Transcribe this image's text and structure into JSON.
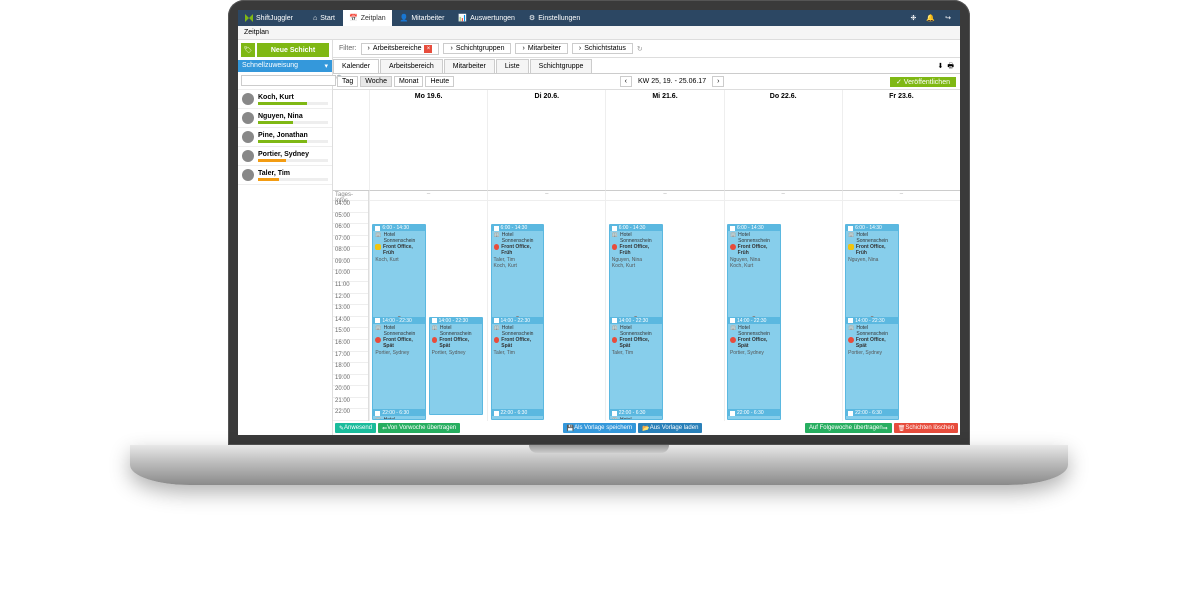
{
  "brand": "ShiftJuggler",
  "nav": {
    "start": "Start",
    "zeitplan": "Zeitplan",
    "mitarbeiter": "Mitarbeiter",
    "auswertungen": "Auswertungen",
    "einstellungen": "Einstellungen"
  },
  "crumb": "Zeitplan",
  "sidebar": {
    "new_shift": "Neue Schicht",
    "quick_assign": "Schnellzuweisung",
    "employees": [
      {
        "name": "Koch, Kurt"
      },
      {
        "name": "Nguyen, Nina"
      },
      {
        "name": "Pine, Jonathan"
      },
      {
        "name": "Portier, Sydney"
      },
      {
        "name": "Taler, Tim"
      }
    ]
  },
  "filter": {
    "label": "Filter:",
    "arbeitsbereiche": "Arbeitsbereiche",
    "schichtgruppen": "Schichtgruppen",
    "mitarbeiter": "Mitarbeiter",
    "schichtstatus": "Schichtstatus"
  },
  "tabs": {
    "kalender": "Kalender",
    "arbeitsbereich": "Arbeitsbereich",
    "mitarbeiter": "Mitarbeiter",
    "liste": "Liste",
    "schichtgruppe": "Schichtgruppe"
  },
  "view": {
    "tag": "Tag",
    "woche": "Woche",
    "monat": "Monat",
    "heute": "Heute",
    "week_label": "KW 25, 19. - 25.06.17",
    "publish": "✓ Veröffentlichen"
  },
  "grid": {
    "tages_infos": "Tages-Infos",
    "hours": [
      "04:00",
      "05:00",
      "06:00",
      "07:00",
      "08:00",
      "09:00",
      "10:00",
      "11:00",
      "12:00",
      "13:00",
      "14:00",
      "15:00",
      "16:00",
      "17:00",
      "18:00",
      "19:00",
      "20:00",
      "21:00",
      "22:00"
    ],
    "days": [
      {
        "label": "Mo 19.6."
      },
      {
        "label": "Di 20.6."
      },
      {
        "label": "Mi 21.6."
      },
      {
        "label": "Do 22.6."
      },
      {
        "label": "Fr 23.6."
      }
    ]
  },
  "shifts": {
    "early_time": "6:00 - 14:30",
    "late_time": "14:00 - 22:30",
    "night_time": "22:00 - 6:30",
    "hotel": "Hotel Sonnenschein",
    "office_frueh": "Front Office, Früh",
    "office_spaet": "Front Office, Spät",
    "emps": {
      "koch": "Koch, Kurt",
      "taler": "Taler, Tim",
      "nguyen": "Nguyen, Nina",
      "portier": "Portier, Sydney",
      "taler_koch": "Taler, Tim\nKoch, Kurt",
      "nguyen_koch": "Nguyen, Nina\nKoch, Kurt"
    }
  },
  "bottom": {
    "anwesend": "Anwesend",
    "vorwoche": "Von Vorwoche übertragen",
    "vorlage_speichern": "Als Vorlage speichern",
    "vorlage_laden": "Aus Vorlage laden",
    "folgewoche": "Auf Folgewoche übertragen",
    "loeschen": "Schichten löschen"
  }
}
